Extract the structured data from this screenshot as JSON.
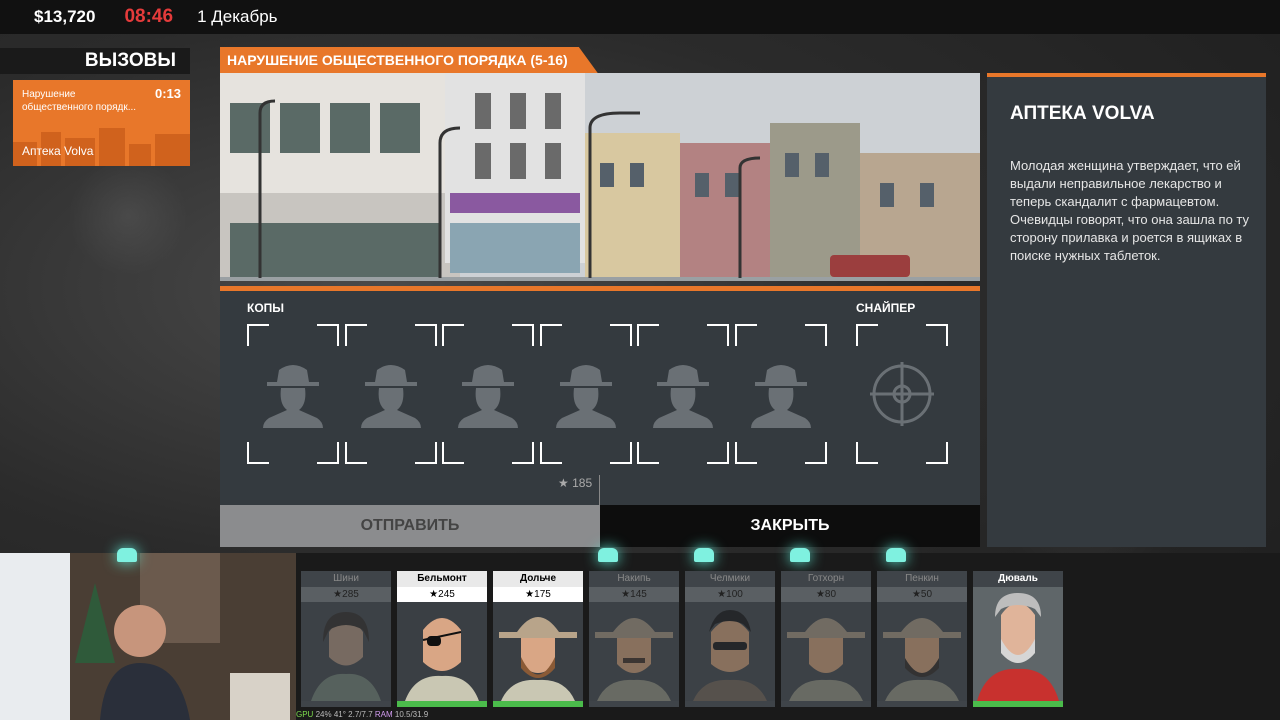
{
  "hud": {
    "money": "$13,720",
    "time": "08:46",
    "date": "1 Декабрь"
  },
  "calls": {
    "header": "ВЫЗОВЫ",
    "items": [
      {
        "title": "Нарушение общественного порядк...",
        "timer": "0:13",
        "location": "Аптека Volva"
      }
    ]
  },
  "event": {
    "title": "НАРУШЕНИЕ ОБЩЕСТВЕННОГО ПОРЯДКА (5-16)",
    "cops_label": "КОПЫ",
    "sniper_label": "СНАЙПЕР",
    "cost": "185",
    "send_label": "ОТПРАВИТЬ",
    "close_label": "ЗАКРЫТЬ"
  },
  "info": {
    "location_name": "АПТЕКА VOLVA",
    "description": "Молодая женщина утверждает, что ей выдали неправильное лекарство и теперь скандалит с фармацевтом. Очевидцы говорят, что она зашла по ту сторону прилавка и роется в ящиках в поиске нужных таблеток."
  },
  "roster": [
    {
      "name": "Шини",
      "rank": "285",
      "status": "busy"
    },
    {
      "name": "Бельмонт",
      "rank": "245",
      "status": "ready"
    },
    {
      "name": "Дольче",
      "rank": "175",
      "status": "ready"
    },
    {
      "name": "Накипь",
      "rank": "145",
      "status": "busy"
    },
    {
      "name": "Челмики",
      "rank": "100",
      "status": "busy"
    },
    {
      "name": "Готхорн",
      "rank": "80",
      "status": "busy"
    },
    {
      "name": "Пенкин",
      "rank": "50",
      "status": "busy"
    },
    {
      "name": "Дюваль",
      "rank": "",
      "status": "hero"
    }
  ],
  "overlay": {
    "gpu_label": "GPU",
    "gpu_value": "24%",
    "temp": "41°",
    "vram": "2.7/7.7",
    "ram_label": "RAM",
    "ram_value": "10.5/31.9"
  },
  "colors": {
    "accent": "#e8772a",
    "panel": "#343a3f",
    "clock": "#e53b3b",
    "ready_bar": "#4bbb4b"
  }
}
